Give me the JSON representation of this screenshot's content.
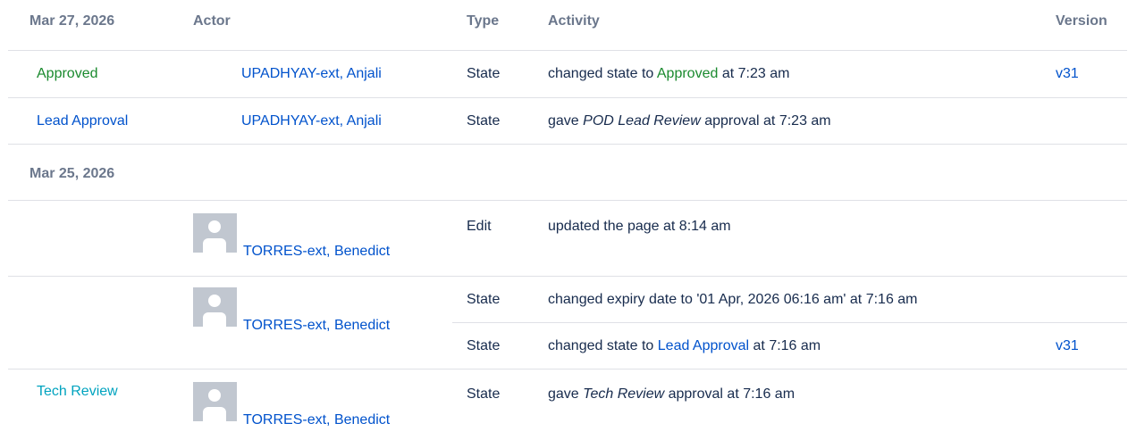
{
  "header": {
    "date": "Mar 27, 2026",
    "actor": "Actor",
    "type": "Type",
    "activity": "Activity",
    "version": "Version"
  },
  "groups": [
    {
      "date": "Mar 27, 2026",
      "rows": [
        {
          "status": "Approved",
          "actor": "UPADHYAY-ext, Anjali",
          "type": "State",
          "activity": {
            "pre": "changed state to ",
            "link": "Approved",
            "post": " at 7:23 am"
          },
          "version": "v31"
        },
        {
          "status": "Lead Approval",
          "actor": "UPADHYAY-ext, Anjali",
          "type": "State",
          "activity": {
            "pre": "gave ",
            "em": "POD Lead Review",
            "post": " approval at 7:23 am"
          },
          "version": ""
        }
      ]
    },
    {
      "date": "Mar 25, 2026",
      "rows": [
        {
          "status": "",
          "actor": "TORRES-ext, Benedict",
          "type": "Edit",
          "activity": {
            "text": "updated the page at 8:14 am"
          },
          "version": ""
        },
        {
          "status": "",
          "actor": "TORRES-ext, Benedict",
          "sub": [
            {
              "type": "State",
              "activity": {
                "text": "changed expiry date to '01 Apr, 2026 06:16 am' at 7:16 am"
              },
              "version": ""
            },
            {
              "type": "State",
              "activity": {
                "pre": "changed state to ",
                "link": "Lead Approval",
                "post": " at 7:16 am"
              },
              "version": "v31"
            }
          ]
        },
        {
          "status": "Tech Review",
          "actor": "TORRES-ext, Benedict",
          "type": "State",
          "activity": {
            "pre": "gave ",
            "em": "Tech Review",
            "post": " approval at 7:16 am"
          },
          "version": ""
        }
      ]
    }
  ]
}
